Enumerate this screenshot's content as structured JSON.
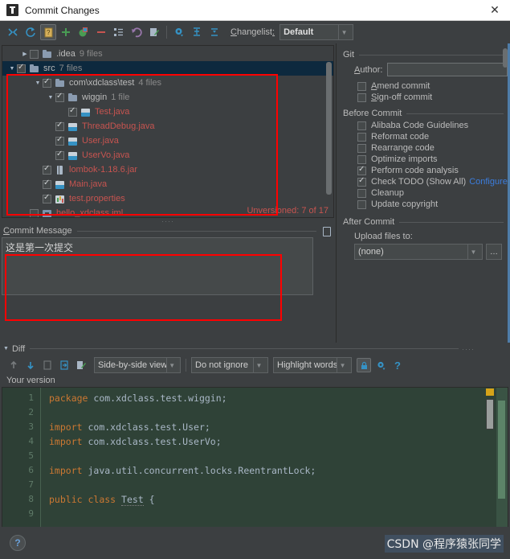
{
  "window": {
    "title": "Commit Changes",
    "close_label": "✕",
    "app_icon": "intellij-idea-icon"
  },
  "toolbar": {
    "icons": [
      {
        "name": "collapse-all-icon",
        "glyph": "collapse"
      },
      {
        "name": "refresh-icon",
        "glyph": "refresh"
      },
      {
        "name": "show-diff-icon",
        "glyph": "diff"
      },
      {
        "name": "add-to-vcs-icon",
        "glyph": "plus"
      },
      {
        "name": "move-to-changelist-icon",
        "glyph": "move"
      },
      {
        "name": "delete-icon",
        "glyph": "minus"
      },
      {
        "name": "group-by-icon",
        "glyph": "group"
      },
      {
        "name": "rollback-icon",
        "glyph": "undo"
      },
      {
        "name": "edit-source-icon",
        "glyph": "edit"
      },
      {
        "name": "settings-icon",
        "glyph": "gear"
      },
      {
        "name": "expand-all-icon",
        "glyph": "expand"
      },
      {
        "name": "collapse-selection-icon",
        "glyph": "collapse2"
      }
    ],
    "changelist_label": "Changelist:",
    "changelist_value": "Default"
  },
  "file_tree": {
    "rows": [
      {
        "indent": 1,
        "twisty": "▶",
        "checkbox": "off",
        "icon": "folder-icon",
        "name": ".idea",
        "count": "9 files",
        "color": "neutral",
        "selected": false
      },
      {
        "indent": 0,
        "twisty": "▼",
        "checkbox": "on",
        "icon": "folder-icon",
        "name": "src",
        "count": "7 files",
        "color": "neutral",
        "selected": true
      },
      {
        "indent": 2,
        "twisty": "▼",
        "checkbox": "on",
        "icon": "folder-icon",
        "name": "com\\xdclass\\test",
        "count": "4 files",
        "color": "neutral",
        "selected": false
      },
      {
        "indent": 3,
        "twisty": "▼",
        "checkbox": "on",
        "icon": "folder-icon",
        "name": "wiggin",
        "count": "1 file",
        "color": "neutral",
        "selected": false
      },
      {
        "indent": 4,
        "twisty": "",
        "checkbox": "on",
        "icon": "java-file-icon",
        "name": "Test.java",
        "count": "",
        "color": "red",
        "selected": false
      },
      {
        "indent": 3,
        "twisty": "",
        "checkbox": "on",
        "icon": "java-file-icon",
        "name": "ThreadDebug.java",
        "count": "",
        "color": "red",
        "selected": false
      },
      {
        "indent": 3,
        "twisty": "",
        "checkbox": "on",
        "icon": "java-file-icon",
        "name": "User.java",
        "count": "",
        "color": "red",
        "selected": false
      },
      {
        "indent": 3,
        "twisty": "",
        "checkbox": "on",
        "icon": "java-file-icon",
        "name": "UserVo.java",
        "count": "",
        "color": "red",
        "selected": false
      },
      {
        "indent": 2,
        "twisty": "",
        "checkbox": "on",
        "icon": "jar-file-icon",
        "name": "lombok-1.18.6.jar",
        "count": "",
        "color": "red",
        "selected": false
      },
      {
        "indent": 2,
        "twisty": "",
        "checkbox": "on",
        "icon": "java-file-icon",
        "name": "Main.java",
        "count": "",
        "color": "red",
        "selected": false
      },
      {
        "indent": 2,
        "twisty": "",
        "checkbox": "on",
        "icon": "properties-file-icon",
        "name": "test.properties",
        "count": "",
        "color": "red",
        "selected": false
      },
      {
        "indent": 1,
        "twisty": "",
        "checkbox": "off",
        "icon": "iml-file-icon",
        "name": "hello_xdclass.iml",
        "count": "",
        "color": "red",
        "selected": false
      }
    ],
    "status": "Unversioned: 7 of 17"
  },
  "commit_message": {
    "label": "Commit Message",
    "value": "这是第一次提交",
    "history_icon": "commit-message-history-icon"
  },
  "git_panel": {
    "group_title": "Git",
    "author_label": "Author:",
    "author_value": "",
    "checks": [
      {
        "label": "Amend commit",
        "checked": false,
        "name": "amend-commit-checkbox"
      },
      {
        "label": "Sign-off commit",
        "checked": false,
        "name": "sign-off-commit-checkbox"
      }
    ],
    "before_commit": {
      "title": "Before Commit",
      "items": [
        {
          "label": "Alibaba Code Guidelines",
          "checked": false,
          "name": "alibaba-code-guidelines-checkbox",
          "link": ""
        },
        {
          "label": "Reformat code",
          "checked": false,
          "name": "reformat-code-checkbox",
          "link": ""
        },
        {
          "label": "Rearrange code",
          "checked": false,
          "name": "rearrange-code-checkbox",
          "link": ""
        },
        {
          "label": "Optimize imports",
          "checked": false,
          "name": "optimize-imports-checkbox",
          "link": ""
        },
        {
          "label": "Perform code analysis",
          "checked": true,
          "name": "perform-code-analysis-checkbox",
          "link": ""
        },
        {
          "label": "Check TODO (Show All)",
          "checked": true,
          "name": "check-todo-checkbox",
          "link": "Configure"
        },
        {
          "label": "Cleanup",
          "checked": false,
          "name": "cleanup-checkbox",
          "link": ""
        },
        {
          "label": "Update copyright",
          "checked": false,
          "name": "update-copyright-checkbox",
          "link": ""
        }
      ]
    },
    "after_commit": {
      "title": "After Commit",
      "upload_label": "Upload files to:",
      "upload_value": "(none)",
      "ellipsis_label": "…"
    }
  },
  "diff": {
    "section_label": "Diff",
    "toolbar": {
      "icons": [
        {
          "name": "previous-difference-icon",
          "glyph": "up"
        },
        {
          "name": "next-difference-icon",
          "glyph": "down"
        },
        {
          "name": "copy-to-left-icon",
          "glyph": "copyleft"
        },
        {
          "name": "copy-to-right-icon",
          "glyph": "copyright"
        },
        {
          "name": "edit-source-icon",
          "glyph": "edit"
        }
      ],
      "viewer_mode": "Side-by-side viewer",
      "whitespace_mode": "Do not ignore",
      "highlight_mode": "Highlight words",
      "lock_icon": "read-only-lock-icon",
      "settings_icon": "gear-icon",
      "help_icon": "help-question-icon"
    },
    "version_label": "Your version",
    "code_lines": [
      {
        "num": "1",
        "tokens": [
          {
            "t": "package",
            "c": "kw"
          },
          {
            "t": " com.xdclass.test.wiggin;",
            "c": "pl"
          }
        ]
      },
      {
        "num": "2",
        "tokens": []
      },
      {
        "num": "3",
        "tokens": [
          {
            "t": "import",
            "c": "kw"
          },
          {
            "t": " com.xdclass.test.User;",
            "c": "pl"
          }
        ]
      },
      {
        "num": "4",
        "tokens": [
          {
            "t": "import",
            "c": "kw"
          },
          {
            "t": " com.xdclass.test.UserVo;",
            "c": "pl"
          }
        ]
      },
      {
        "num": "5",
        "tokens": []
      },
      {
        "num": "6",
        "tokens": [
          {
            "t": "import",
            "c": "kw"
          },
          {
            "t": " java.util.concurrent.locks.ReentrantLock;",
            "c": "pl"
          }
        ]
      },
      {
        "num": "7",
        "tokens": []
      },
      {
        "num": "8",
        "tokens": [
          {
            "t": "public",
            "c": "kw"
          },
          {
            "t": " ",
            "c": "pl"
          },
          {
            "t": "class",
            "c": "kw"
          },
          {
            "t": " ",
            "c": "pl"
          },
          {
            "t": "Test",
            "c": "cls"
          },
          {
            "t": " {",
            "c": "pl"
          }
        ]
      },
      {
        "num": "9",
        "tokens": []
      }
    ]
  },
  "bottom": {
    "help_label": "?",
    "watermark": "CSDN @程序猿张同学"
  },
  "colors": {
    "accent_blue": "#3b7ddd",
    "annotation_red": "#ff0000",
    "file_red": "#c75450",
    "diff_added_bg": "#2f4237",
    "selection_blue": "#0d293e"
  }
}
